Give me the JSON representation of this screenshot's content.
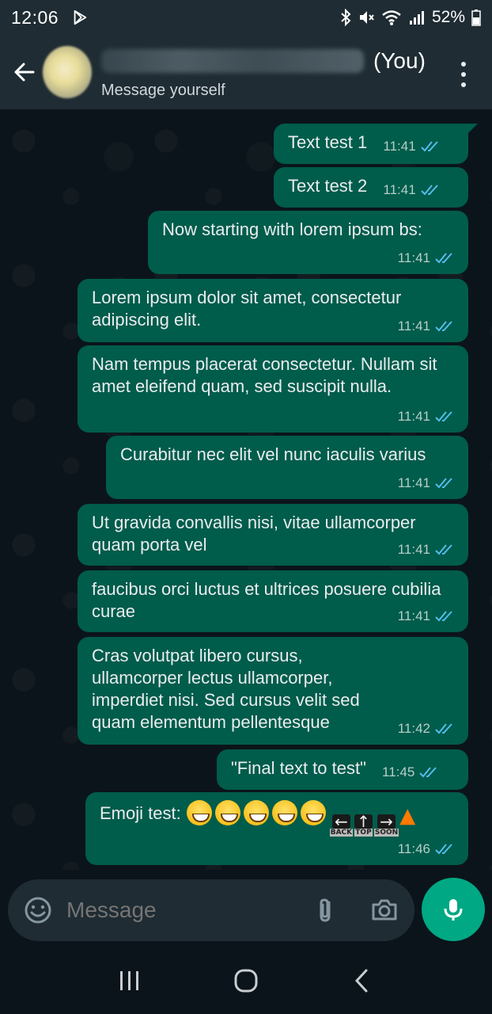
{
  "status_bar": {
    "time": "12:06",
    "battery": "52%"
  },
  "header": {
    "name_suffix": "(You)",
    "subtitle": "Message yourself"
  },
  "messages": [
    {
      "text": "Text test 1",
      "time": "11:41"
    },
    {
      "text": "Text test 2",
      "time": "11:41"
    },
    {
      "text": "Now starting with lorem ipsum bs:",
      "time": "11:41"
    },
    {
      "text": "Lorem ipsum dolor sit amet, consectetur adipiscing elit.",
      "time": "11:41"
    },
    {
      "text": "Nam tempus placerat consectetur. Nullam sit amet eleifend quam, sed suscipit nulla.",
      "time": "11:41"
    },
    {
      "text": "Curabitur nec elit vel nunc iaculis varius",
      "time": "11:41"
    },
    {
      "text": "Ut gravida convallis nisi, vitae ullamcorper quam porta vel",
      "time": "11:41"
    },
    {
      "text": "faucibus orci luctus et ultrices posuere cubilia curae",
      "time": "11:41"
    },
    {
      "text": "Cras volutpat libero cursus, ullamcorper lectus ullamcorper, imperdiet nisi. Sed cursus velit sed quam elementum pellentesque",
      "time": "11:42"
    },
    {
      "text": "\"Final text to test\"",
      "time": "11:45"
    },
    {
      "text": "Emoji test:",
      "time": "11:46",
      "signs": [
        "BACK",
        "TOP",
        "SOON"
      ]
    }
  ],
  "input": {
    "placeholder": "Message"
  },
  "icons": {
    "back": "arrow-left-icon",
    "menu": "more-vertical-icon",
    "emoji": "smiley-icon",
    "attach": "paperclip-icon",
    "camera": "camera-icon",
    "mic": "microphone-icon",
    "read": "double-check-icon"
  },
  "colors": {
    "bubble": "#005c4b",
    "header": "#1f2c33",
    "accent": "#00a884",
    "read_tick": "#53bdeb"
  }
}
